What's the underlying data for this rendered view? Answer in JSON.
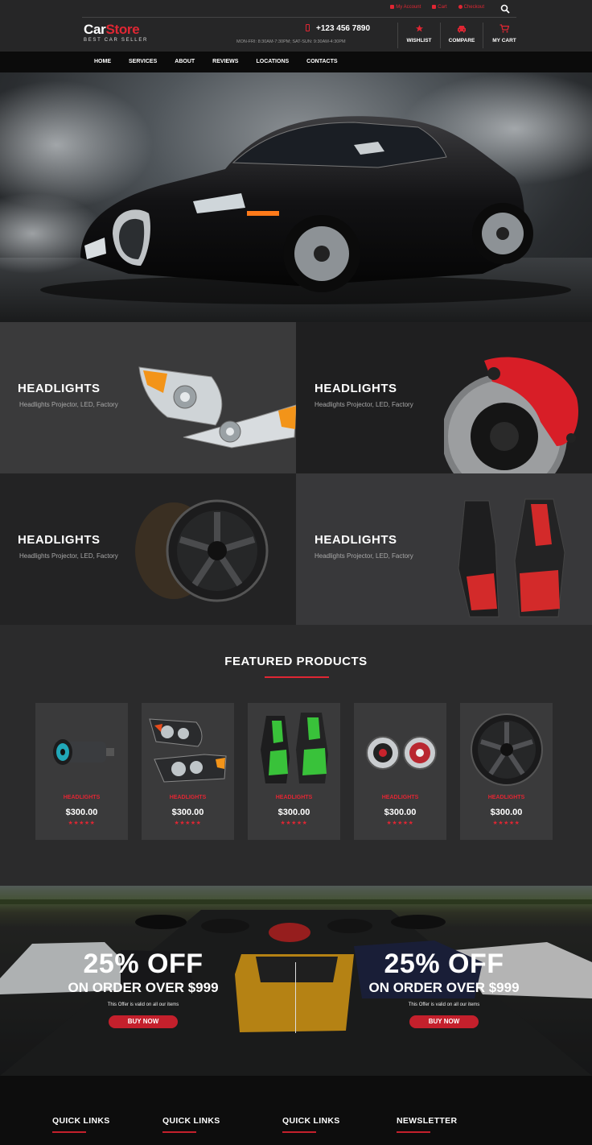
{
  "header": {
    "top_links": [
      {
        "label": "My Account",
        "icon": "user-icon"
      },
      {
        "label": "Cart",
        "icon": "cart-icon"
      },
      {
        "label": "Checkout",
        "icon": "check-icon"
      }
    ],
    "logo_part1": "Car",
    "logo_part2": "Store",
    "tagline": "BEST CAR SELLER",
    "phone": "+123 456 7890",
    "hours": "MON-FRI: 8:30AM-7:30PM; SAT-SUN: 9:30AM-4:30PM",
    "actions": [
      {
        "label": "WISHLIST",
        "icon": "star-icon"
      },
      {
        "label": "COMPARE",
        "icon": "car-icon"
      },
      {
        "label": "MY CART",
        "icon": "cart-icon"
      }
    ]
  },
  "nav": {
    "items": [
      "HOME",
      "SERVICES",
      "ABOUT",
      "REVIEWS",
      "LOCATIONS",
      "CONTACTS"
    ]
  },
  "categories": [
    {
      "title": "HEADLIGHTS",
      "subtitle": "Headlights Projector, LED, Factory",
      "image": "headlights"
    },
    {
      "title": "HEADLIGHTS",
      "subtitle": "Headlights Projector, LED, Factory",
      "image": "brake-disc"
    },
    {
      "title": "HEADLIGHTS",
      "subtitle": "Headlights Projector, LED, Factory",
      "image": "wheel-rim"
    },
    {
      "title": "HEADLIGHTS",
      "subtitle": "Headlights Projector, LED, Factory",
      "image": "racing-seats"
    }
  ],
  "featured": {
    "title": "FEATURED PRODUCTS",
    "products": [
      {
        "name": "HEADLIGHTS",
        "price": "$300.00",
        "stars": "★★★★★",
        "image": "speaker"
      },
      {
        "name": "HEADLIGHTS",
        "price": "$300.00",
        "stars": "★★★★★",
        "image": "headlights"
      },
      {
        "name": "HEADLIGHTS",
        "price": "$300.00",
        "stars": "★★★★★",
        "image": "green-seats"
      },
      {
        "name": "HEADLIGHTS",
        "price": "$300.00",
        "stars": "★★★★★",
        "image": "car-speakers"
      },
      {
        "name": "HEADLIGHTS",
        "price": "$300.00",
        "stars": "★★★★★",
        "image": "wheel-rim"
      }
    ]
  },
  "promo": {
    "offers": [
      {
        "big": "25% OFF",
        "mid": "ON ORDER OVER $999",
        "small": "This Offer is valid on all our items",
        "button": "BUY NOW"
      },
      {
        "big": "25% OFF",
        "mid": "ON ORDER OVER $999",
        "small": "This Offer is valid on all our items",
        "button": "BUY NOW"
      }
    ]
  },
  "footer": {
    "columns": [
      "QUICK LINKS",
      "QUICK LINKS",
      "QUICK LINKS",
      "NEWSLETTER"
    ]
  },
  "colors": {
    "accent": "#e02633",
    "button": "#c4202c",
    "background": "#2b2b2c",
    "header": "#262627",
    "nav": "#0b0b0b"
  }
}
